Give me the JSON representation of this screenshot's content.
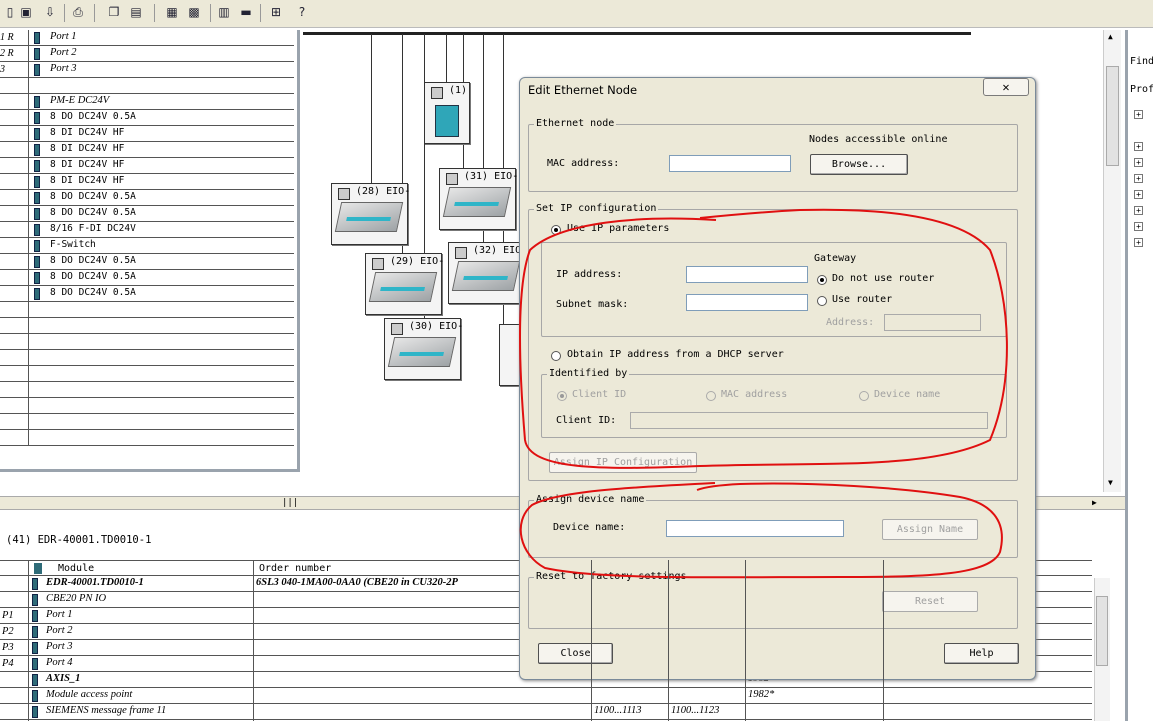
{
  "left_rows": [
    {
      "slot": "1 R",
      "label": "Port 1"
    },
    {
      "slot": "2 R",
      "label": "Port 2"
    },
    {
      "slot": "3",
      "label": "Port 3"
    },
    {
      "slot": "",
      "label": ""
    },
    {
      "slot": "",
      "label": "PM-E DC24V"
    },
    {
      "slot": "",
      "label": "8 DO DC24V 0.5A"
    },
    {
      "slot": "",
      "label": "8 DI DC24V HF"
    },
    {
      "slot": "",
      "label": "8 DI DC24V HF"
    },
    {
      "slot": "",
      "label": "8 DI DC24V HF"
    },
    {
      "slot": "",
      "label": "8 DI DC24V HF"
    },
    {
      "slot": "",
      "label": "8 DO DC24V 0.5A"
    },
    {
      "slot": "",
      "label": "8 DO DC24V 0.5A"
    },
    {
      "slot": "",
      "label": "8/16 F-DI DC24V"
    },
    {
      "slot": "",
      "label": "F-Switch"
    },
    {
      "slot": "",
      "label": "8 DO DC24V 0.5A"
    },
    {
      "slot": "",
      "label": "8 DO DC24V 0.5A"
    },
    {
      "slot": "",
      "label": "8 DO DC24V 0.5A"
    }
  ],
  "nodes": {
    "n1": "(1)",
    "n28": "(28) EIO-",
    "n29": "(29) EIO-",
    "n30": "(30) EIO-",
    "n31": "(31) EIO-",
    "n32": "(32) EIO-"
  },
  "bottom": {
    "title": "(41)   EDR-40001.TD0010-1",
    "col_module": "Module",
    "col_order": "Order number",
    "rows": [
      {
        "slot": "",
        "module": "EDR-40001.TD0010-1",
        "order": "6SL3 040-1MA00-0AA0  (CBE20 in CU320-2P",
        "c3": "",
        "c4": "",
        "c5": ""
      },
      {
        "slot": "",
        "module": "CBE20 PN IO",
        "order": "",
        "c3": "",
        "c4": "",
        "c5": ""
      },
      {
        "slot": "P1",
        "module": "Port 1",
        "order": "",
        "c3": "",
        "c4": "",
        "c5": ""
      },
      {
        "slot": "P2",
        "module": "Port 2",
        "order": "",
        "c3": "",
        "c4": "",
        "c5": ""
      },
      {
        "slot": "P3",
        "module": "Port 3",
        "order": "",
        "c3": "",
        "c4": "",
        "c5": ""
      },
      {
        "slot": "P4",
        "module": "Port 4",
        "order": "",
        "c3": "",
        "c4": "",
        "c5": ""
      },
      {
        "slot": "",
        "module": "AXIS_1",
        "order": "",
        "c3": "",
        "c4": "",
        "c5": "1982*"
      },
      {
        "slot": "",
        "module": "Module access point",
        "order": "",
        "c3": "",
        "c4": "",
        "c5": "1982*"
      },
      {
        "slot": "",
        "module": "SIEMENS message frame 11",
        "order": "",
        "c3": "1100...1113",
        "c4": "1100...1123",
        "c5": ""
      }
    ]
  },
  "right_panel": {
    "find": "Find",
    "prof": "Prof"
  },
  "dialog": {
    "title": "Edit Ethernet Node",
    "ethernet_node": "Ethernet node",
    "nodes_online": "Nodes accessible online",
    "mac_label": "MAC address:",
    "browse": "Browse...",
    "set_ip": "Set IP configuration",
    "use_ip": "Use IP parameters",
    "ip_label": "IP address:",
    "subnet_label": "Subnet mask:",
    "gateway": "Gateway",
    "no_router": "Do not use router",
    "use_router": "Use router",
    "address_label": "Address:",
    "dhcp": "Obtain IP address from a DHCP server",
    "identified_by": "Identified by",
    "client_id_opt": "Client ID",
    "mac_opt": "MAC address",
    "device_name_opt": "Device name",
    "client_id_label": "Client ID:",
    "assign_ip": "Assign IP Configuration",
    "assign_device": "Assign device name",
    "device_name_label": "Device name:",
    "assign_name": "Assign Name",
    "reset_group": "Reset to factory settings",
    "reset": "Reset",
    "close": "Close",
    "help": "Help"
  },
  "colors": {
    "annotation": "#e01010",
    "dialog_bg": "#ece9d8",
    "accent": "#2fb5c8"
  }
}
